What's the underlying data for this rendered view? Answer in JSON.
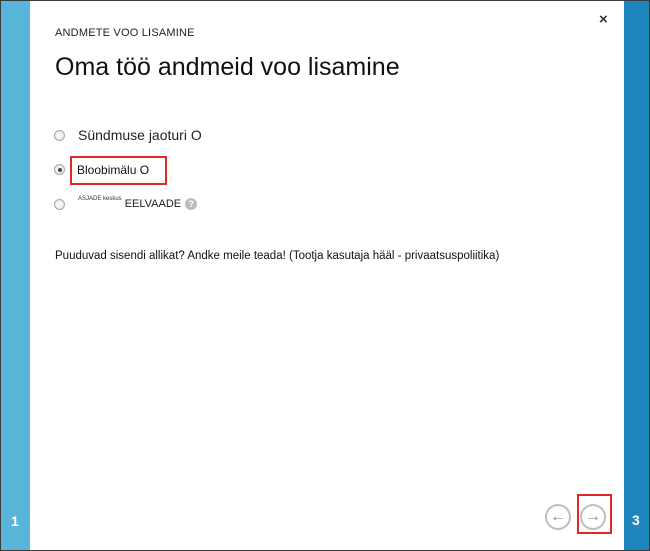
{
  "wizard": {
    "overline": "ANDMETE VOO LISAMINE",
    "title": "Oma töö andmeid voo lisamine",
    "close_icon": "×",
    "step_left": "1",
    "step_right": "3",
    "options": [
      {
        "label": "Sündmuse jaoturi O",
        "selected": false
      },
      {
        "label": "Bloobimälu O",
        "selected": true
      },
      {
        "label_small": "ASJADE keskus",
        "label_preview": "EELVAADE",
        "selected": false
      }
    ],
    "help_icon": "?",
    "missing_text": "Puuduvad sisendi allikat? Andke meile teada! (Tootja kasutaja hääl - privaatsuspoliitika)",
    "prev_icon": "←",
    "next_icon": "→"
  },
  "colors": {
    "left_bar": "#59b4d9",
    "right_bar": "#1f85bd",
    "highlight": "#e02828"
  }
}
